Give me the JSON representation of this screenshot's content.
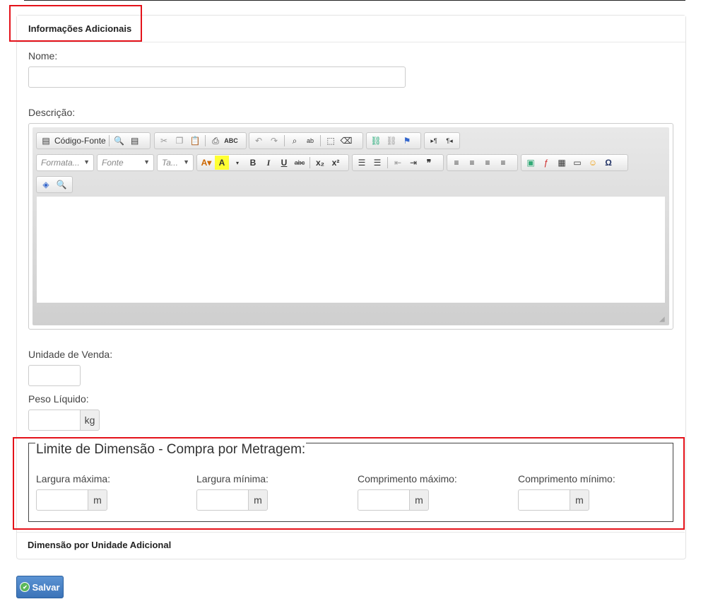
{
  "panel": {
    "title": "Informações Adicionais"
  },
  "fields": {
    "nome_label": "Nome:",
    "descricao_label": "Descrição:",
    "unidade_label": "Unidade de Venda:",
    "peso_label": "Peso Líquido:",
    "peso_unit": "kg"
  },
  "editor": {
    "source_label": "Código-Fonte",
    "format_placeholder": "Formata...",
    "font_placeholder": "Fonte",
    "size_placeholder": "Ta..."
  },
  "limite": {
    "legend": "Limite de Dimensão - Compra por Metragem:",
    "items": [
      {
        "label": "Largura máxima:",
        "unit": "m"
      },
      {
        "label": "Largura mínima:",
        "unit": "m"
      },
      {
        "label": "Comprimento máximo:",
        "unit": "m"
      },
      {
        "label": "Comprimento mínimo:",
        "unit": "m"
      }
    ]
  },
  "dimensao": {
    "title": "Dimensão por Unidade Adicional"
  },
  "save_label": "Salvar"
}
